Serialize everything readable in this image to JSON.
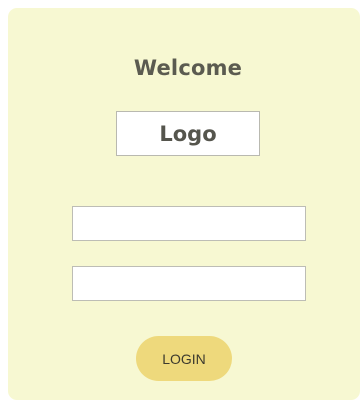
{
  "card": {
    "background": "#f7f8d2"
  },
  "header": {
    "title": "Welcome"
  },
  "logo": {
    "text": "Logo"
  },
  "form": {
    "username": {
      "value": "",
      "placeholder": ""
    },
    "password": {
      "value": "",
      "placeholder": ""
    },
    "login_label": "LOGIN",
    "login_color": "#eed97c"
  }
}
